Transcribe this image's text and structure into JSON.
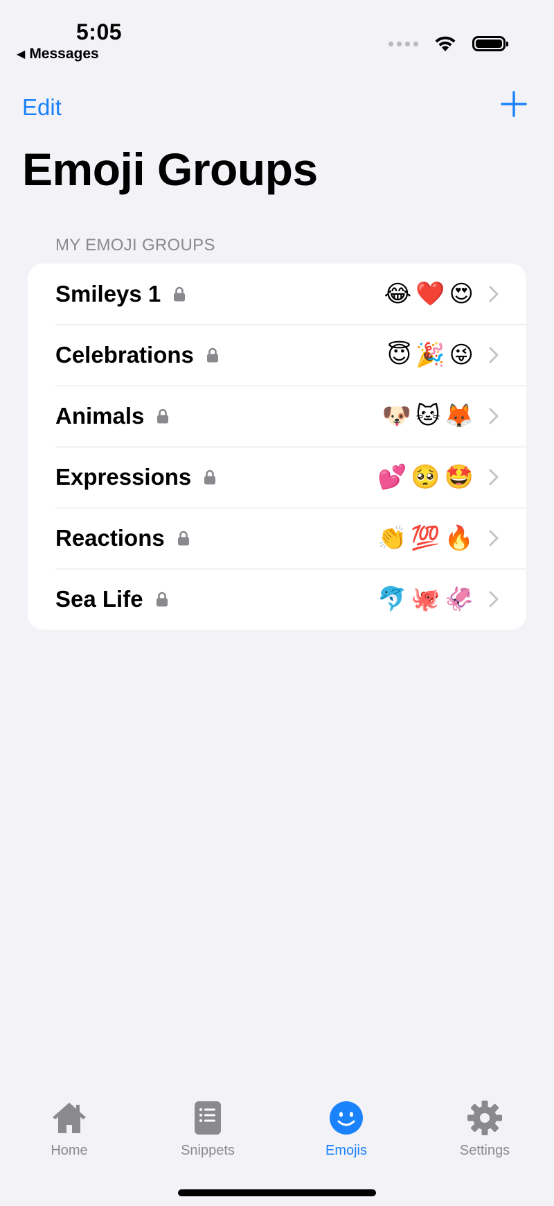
{
  "status_bar": {
    "time": "5:05",
    "back_app": "Messages"
  },
  "nav": {
    "edit_label": "Edit",
    "add_icon": "plus-icon",
    "title": "Emoji Groups"
  },
  "section": {
    "header": "MY EMOJI GROUPS",
    "groups": [
      {
        "name": "Smileys 1",
        "locked": true,
        "emojis": [
          "😂",
          "❤️",
          "😍"
        ]
      },
      {
        "name": "Celebrations",
        "locked": true,
        "emojis": [
          "😇",
          "🎉",
          "😜"
        ]
      },
      {
        "name": "Animals",
        "locked": true,
        "emojis": [
          "🐶",
          "🐱",
          "🦊"
        ]
      },
      {
        "name": "Expressions",
        "locked": true,
        "emojis": [
          "💕",
          "🥺",
          "🤩"
        ]
      },
      {
        "name": "Reactions",
        "locked": true,
        "emojis": [
          "👏",
          "💯",
          "🔥"
        ]
      },
      {
        "name": "Sea Life",
        "locked": true,
        "emojis": [
          "🐬",
          "🐙",
          "🦑"
        ]
      }
    ]
  },
  "tabs": [
    {
      "label": "Home",
      "icon": "house-icon",
      "active": false
    },
    {
      "label": "Snippets",
      "icon": "snippets-icon",
      "active": false
    },
    {
      "label": "Emojis",
      "icon": "smiley-icon",
      "active": true
    },
    {
      "label": "Settings",
      "icon": "gear-icon",
      "active": false
    }
  ],
  "colors": {
    "accent": "#1a82fb",
    "background": "#f2f2f7",
    "secondary_text": "#8a8a8e"
  }
}
